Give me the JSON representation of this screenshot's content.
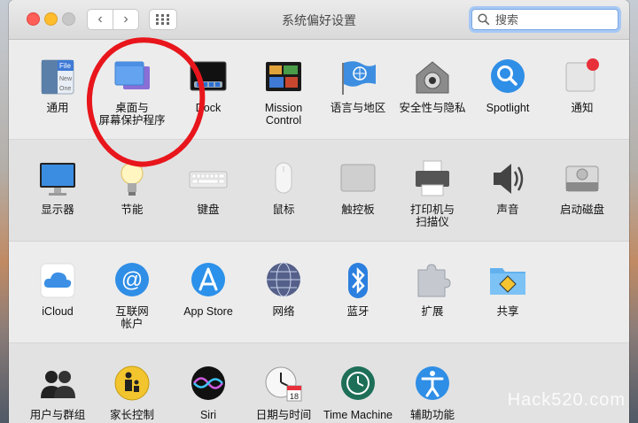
{
  "window": {
    "title": "系统偏好设置",
    "search_placeholder": "搜索",
    "back_glyph": "‹",
    "forward_glyph": "›"
  },
  "sections": [
    {
      "items": [
        {
          "id": "general",
          "label": "通用",
          "icon": "general-icon"
        },
        {
          "id": "desktop",
          "label": "桌面与\n屏幕保护程序",
          "icon": "desktop-screensaver-icon"
        },
        {
          "id": "dock",
          "label": "Dock",
          "icon": "dock-icon"
        },
        {
          "id": "mission",
          "label": "Mission\nControl",
          "icon": "mission-control-icon"
        },
        {
          "id": "language",
          "label": "语言与地区",
          "icon": "language-region-icon"
        },
        {
          "id": "security",
          "label": "安全性与隐私",
          "icon": "security-privacy-icon"
        },
        {
          "id": "spotlight",
          "label": "Spotlight",
          "icon": "spotlight-icon"
        },
        {
          "id": "notifications",
          "label": "通知",
          "icon": "notifications-icon"
        }
      ]
    },
    {
      "items": [
        {
          "id": "displays",
          "label": "显示器",
          "icon": "displays-icon"
        },
        {
          "id": "energy",
          "label": "节能",
          "icon": "energy-saver-icon"
        },
        {
          "id": "keyboard",
          "label": "键盘",
          "icon": "keyboard-icon"
        },
        {
          "id": "mouse",
          "label": "鼠标",
          "icon": "mouse-icon"
        },
        {
          "id": "trackpad",
          "label": "触控板",
          "icon": "trackpad-icon"
        },
        {
          "id": "printers",
          "label": "打印机与\n扫描仪",
          "icon": "printer-scanner-icon"
        },
        {
          "id": "sound",
          "label": "声音",
          "icon": "sound-icon"
        },
        {
          "id": "startup",
          "label": "启动磁盘",
          "icon": "startup-disk-icon"
        }
      ]
    },
    {
      "items": [
        {
          "id": "icloud",
          "label": "iCloud",
          "icon": "icloud-icon"
        },
        {
          "id": "internet",
          "label": "互联网\n帐户",
          "icon": "internet-accounts-icon"
        },
        {
          "id": "appstore",
          "label": "App Store",
          "icon": "app-store-icon"
        },
        {
          "id": "network",
          "label": "网络",
          "icon": "network-icon"
        },
        {
          "id": "bluetooth",
          "label": "蓝牙",
          "icon": "bluetooth-icon"
        },
        {
          "id": "extensions",
          "label": "扩展",
          "icon": "extensions-icon"
        },
        {
          "id": "sharing",
          "label": "共享",
          "icon": "sharing-icon"
        }
      ]
    },
    {
      "items": [
        {
          "id": "users",
          "label": "用户与群组",
          "icon": "users-groups-icon"
        },
        {
          "id": "parental",
          "label": "家长控制",
          "icon": "parental-controls-icon"
        },
        {
          "id": "siri",
          "label": "Siri",
          "icon": "siri-icon"
        },
        {
          "id": "datetime",
          "label": "日期与时间",
          "icon": "date-time-icon"
        },
        {
          "id": "timemachine",
          "label": "Time Machine",
          "icon": "time-machine-icon"
        },
        {
          "id": "accessibility",
          "label": "辅助功能",
          "icon": "accessibility-icon"
        }
      ]
    }
  ],
  "icon_text": {
    "general_a": "File",
    "general_b": "New",
    "general_c": "One",
    "calendar_day": "18"
  },
  "watermark": "Hack520.com",
  "colors": {
    "annotation_red": "#e8161c",
    "search_focus": "#a6c8f5"
  }
}
